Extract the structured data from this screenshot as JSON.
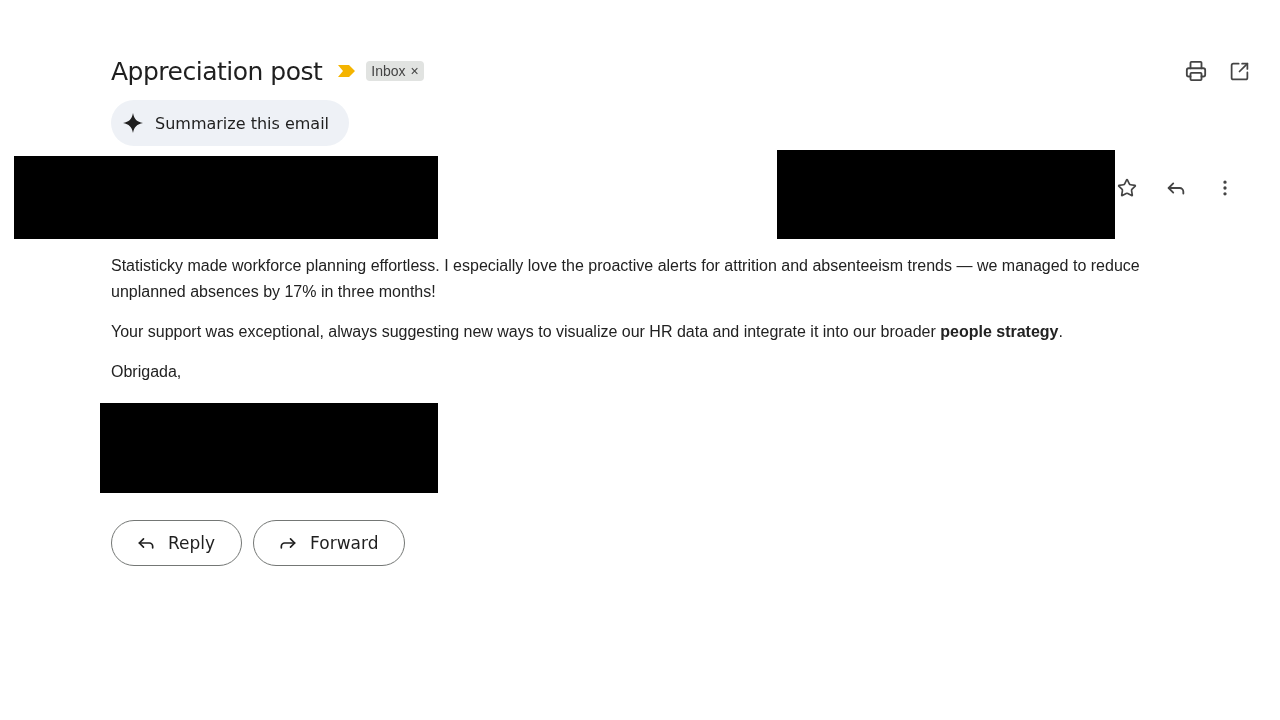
{
  "subject": "Appreciation post",
  "label": {
    "text": "Inbox",
    "close": "×"
  },
  "summarize_button": "Summarize this email",
  "body": [
    "Statisticky made workforce planning effortless. I especially love the proactive alerts for attrition and absenteeism trends — we managed to reduce unplanned absences by 17% in three months!",
    "Your support was exceptional, always suggesting new ways to visualize our HR data and integrate it into our broader **people strategy**.",
    "Obrigada,"
  ],
  "buttons": [
    "Reply",
    "Forward"
  ]
}
